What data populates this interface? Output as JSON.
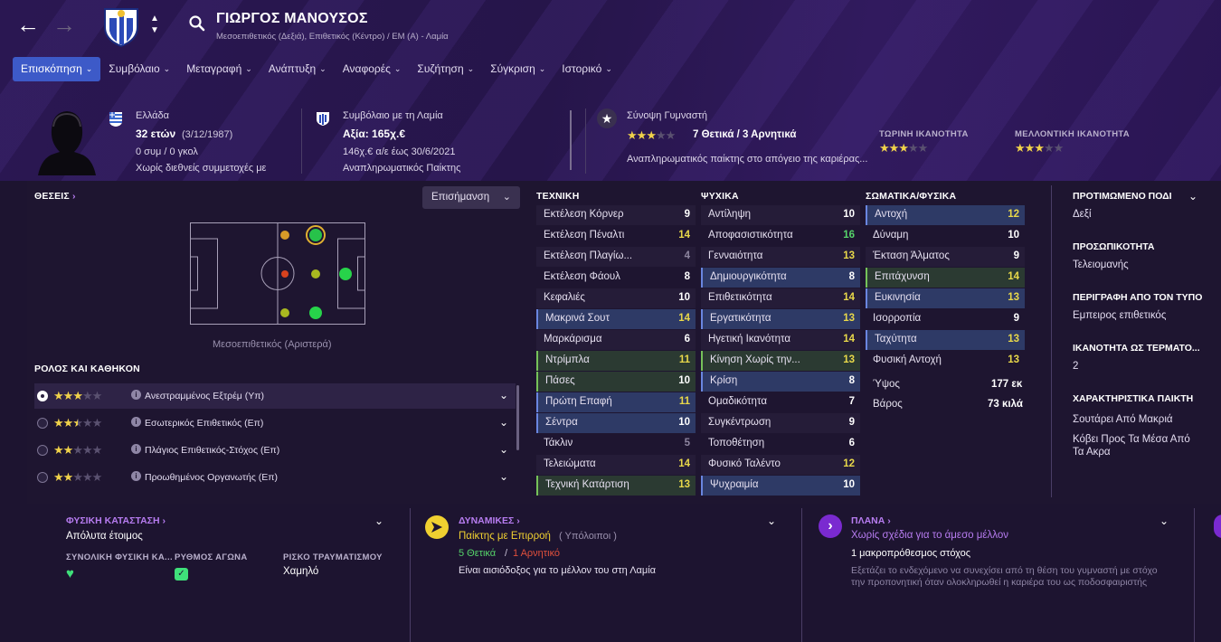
{
  "header": {
    "player_name": "ΓΙΩΡΓΟΣ ΜΑΝΟΥΣΟΣ",
    "subtitle": "Μεσοεπιθετικός (Δεξιά), Επιθετικός (Κέντρο) / ΕΜ (Α) - Λαμία",
    "back_icon": "←",
    "forward_icon": "→"
  },
  "tabs": [
    {
      "label": "Επισκόπηση",
      "active": true
    },
    {
      "label": "Συμβόλαιο"
    },
    {
      "label": "Μεταγραφή"
    },
    {
      "label": "Ανάπτυξη"
    },
    {
      "label": "Αναφορές"
    },
    {
      "label": "Συζήτηση"
    },
    {
      "label": "Σύγκριση"
    },
    {
      "label": "Ιστορικό"
    }
  ],
  "info": {
    "nation": "Ελλάδα",
    "age": "32 ετών",
    "dob": "(3/12/1987)",
    "caps": "0 συμ / 0 γκολ",
    "intl": "Χωρίς διεθνείς συμμετοχές με",
    "contract_title": "Συμβόλαιο με τη Λαμία",
    "value": "Αξία: 165χ.€",
    "wage": "146χ.€ α/ε έως 30/6/2021",
    "squad_status": "Αναπληρωματικός Παίκτης",
    "coach_summary": "Σύνοψη Γυμναστή",
    "coach_verdict": "7 Θετικά / 3 Αρνητικά",
    "coach_text": "Αναπληρωματικός παίκτης στο απόγειο της καριέρας...",
    "current_ability_label": "ΤΩΡΙΝΗ ΙΚΑΝΟΤΗΤΑ",
    "potential_ability_label": "ΜΕΛΛΟΝΤΙΚΗ ΙΚΑΝΟΤΗΤΑ",
    "coach_stars": 3,
    "current_stars": 3,
    "potential_stars": 3
  },
  "positions": {
    "heading": "ΘΕΣΕΙΣ",
    "highlight_button": "Επισήμανση",
    "caption": "Μεσοεπιθετικός (Αριστερά)"
  },
  "roles": {
    "heading": "ΡΟΛΟΣ ΚΑΙ ΚΑΘΗΚΟΝ",
    "items": [
      {
        "name": "Ανεστραμμένος Εξτρέμ (Υπ)",
        "stars": 3,
        "selected": true
      },
      {
        "name": "Εσωτερικός Επιθετικός (Επ)",
        "stars": 2.5
      },
      {
        "name": "Πλάγιος Επιθετικός-Στόχος (Επ)",
        "stars": 2
      },
      {
        "name": "Προωθημένος Οργανωτής (Επ)",
        "stars": 2
      }
    ]
  },
  "technical": {
    "heading": "ΤΕΧΝΙΚΗ",
    "items": [
      {
        "name": "Εκτέλεση Κόρνερ",
        "value": "9",
        "hl": "plain",
        "color": "white"
      },
      {
        "name": "Εκτέλεση Πέναλτι",
        "value": "14",
        "hl": "none",
        "color": "yellow"
      },
      {
        "name": "Εκτέλεση Πλαγίω...",
        "value": "4",
        "hl": "plain",
        "color": "grey"
      },
      {
        "name": "Εκτέλεση Φάουλ",
        "value": "8",
        "hl": "none",
        "color": "white"
      },
      {
        "name": "Κεφαλιές",
        "value": "10",
        "hl": "plain",
        "color": "white"
      },
      {
        "name": "Μακρινά Σουτ",
        "value": "14",
        "hl": "blue",
        "color": "yellow"
      },
      {
        "name": "Μαρκάρισμα",
        "value": "6",
        "hl": "plain",
        "color": "white"
      },
      {
        "name": "Ντρίμπλα",
        "value": "11",
        "hl": "green",
        "color": "yellow"
      },
      {
        "name": "Πάσες",
        "value": "10",
        "hl": "green",
        "color": "white"
      },
      {
        "name": "Πρώτη Επαφή",
        "value": "11",
        "hl": "blue",
        "color": "yellow"
      },
      {
        "name": "Σέντρα",
        "value": "10",
        "hl": "blue",
        "color": "white"
      },
      {
        "name": "Τάκλιν",
        "value": "5",
        "hl": "none",
        "color": "grey"
      },
      {
        "name": "Τελειώματα",
        "value": "14",
        "hl": "plain",
        "color": "yellow"
      },
      {
        "name": "Τεχνική Κατάρτιση",
        "value": "13",
        "hl": "green",
        "color": "yellow"
      }
    ]
  },
  "mental": {
    "heading": "ΨΥΧΙΚΑ",
    "items": [
      {
        "name": "Αντίληψη",
        "value": "10",
        "hl": "plain",
        "color": "white"
      },
      {
        "name": "Αποφασιστικότητα",
        "value": "16",
        "hl": "none",
        "color": "green"
      },
      {
        "name": "Γενναιότητα",
        "value": "13",
        "hl": "plain",
        "color": "yellow"
      },
      {
        "name": "Δημιουργικότητα",
        "value": "8",
        "hl": "blue",
        "color": "white"
      },
      {
        "name": "Επιθετικότητα",
        "value": "14",
        "hl": "plain",
        "color": "yellow"
      },
      {
        "name": "Εργατικότητα",
        "value": "13",
        "hl": "blue",
        "color": "yellow"
      },
      {
        "name": "Ηγετική Ικανότητα",
        "value": "14",
        "hl": "plain",
        "color": "yellow"
      },
      {
        "name": "Κίνηση Χωρίς την...",
        "value": "13",
        "hl": "green",
        "color": "yellow"
      },
      {
        "name": "Κρίση",
        "value": "8",
        "hl": "blue",
        "color": "white"
      },
      {
        "name": "Ομαδικότητα",
        "value": "7",
        "hl": "none",
        "color": "white"
      },
      {
        "name": "Συγκέντρωση",
        "value": "9",
        "hl": "plain",
        "color": "white"
      },
      {
        "name": "Τοποθέτηση",
        "value": "6",
        "hl": "none",
        "color": "white"
      },
      {
        "name": "Φυσικό Ταλέντο",
        "value": "12",
        "hl": "plain",
        "color": "yellow"
      },
      {
        "name": "Ψυχραιμία",
        "value": "10",
        "hl": "blue",
        "color": "white"
      }
    ]
  },
  "physical": {
    "heading": "ΣΩΜΑΤΙΚΑ/ΦΥΣΙΚΑ",
    "items": [
      {
        "name": "Αντοχή",
        "value": "12",
        "hl": "blue",
        "color": "yellow"
      },
      {
        "name": "Δύναμη",
        "value": "10",
        "hl": "none",
        "color": "white"
      },
      {
        "name": "Έκταση Άλματος",
        "value": "9",
        "hl": "plain",
        "color": "white"
      },
      {
        "name": "Επιτάχυνση",
        "value": "14",
        "hl": "green",
        "color": "yellow"
      },
      {
        "name": "Ευκινησία",
        "value": "13",
        "hl": "blue",
        "color": "yellow"
      },
      {
        "name": "Ισορροπία",
        "value": "9",
        "hl": "none",
        "color": "white"
      },
      {
        "name": "Ταχύτητα",
        "value": "13",
        "hl": "blue",
        "color": "yellow"
      },
      {
        "name": "Φυσική Αντοχή",
        "value": "13",
        "hl": "none",
        "color": "yellow"
      }
    ],
    "height_label": "Ύψος",
    "height": "177 εκ",
    "weight_label": "Βάρος",
    "weight": "73 κιλά"
  },
  "side": {
    "foot_h": "ΠΡΟΤΙΜΩΜΕΝΟ ΠΟΔΙ",
    "foot_v": "Δεξί",
    "pers_h": "ΠΡΟΣΩΠΙΚΟΤΗΤΑ",
    "pers_v": "Τελειομανής",
    "media_h": "ΠΕΡΙΓΡΑΦΗ ΑΠΟ ΤΟΝ ΤΥΠΟ",
    "media_v": "Εμπειρος επιθετικός",
    "goal_h": "ΙΚΑΝΟΤΗΤΑ ΩΣ ΤΕΡΜΑΤΟ...",
    "goal_v": "2",
    "traits_h": "ΧΑΡΑΚΤΗΡΙΣΤΙΚΑ ΠΑΙΚΤΗ",
    "trait1": "Σουτάρει Από Μακριά",
    "trait2a": "Κόβει Προς Τα Μέσα Από",
    "trait2b": "Τα Ακρα"
  },
  "bottom": {
    "cond_h": "ΦΥΣΙΚΗ ΚΑΤΑΣΤΑΣΗ",
    "cond_v": "Απόλυτα έτοιμος",
    "cond_c1": "ΣΥΝΟΛΙΚΗ ΦΥΣΙΚΗ ΚΑ...",
    "cond_c2": "ΡΥΘΜΟΣ ΑΓΩΝΑ",
    "cond_c3": "ΡΙΣΚΟ ΤΡΑΥΜΑΤΙΣΜΟΥ",
    "cond_risk": "Χαμηλό",
    "dyn_h": "ΔΥΝΑΜΙΚΕΣ",
    "dyn_v": "Παίκτης με Επιρροή",
    "dyn_v2": "( Υπόλοιποι )",
    "dyn_pos": "5 Θετικά",
    "dyn_sep": "/",
    "dyn_neg": "1 Αρνητικό",
    "dyn_text": "Είναι αισιόδοξος για το μέλλον του στη Λαμία",
    "plans_h": "ΠΛΑΝΑ",
    "plans_v": "Χωρίς σχέδια για το άμεσο μέλλον",
    "plans_goal": "1 μακροπρόθεσμος στόχος",
    "plans_t1": "Εξετάζει το ενδεχόμενο να συνεχίσει από τη θέση του γυμναστή με στόχο",
    "plans_t2": "την προπονητική όταν ολοκληρωθεί η καριέρα του ως ποδοσφαιριστής"
  },
  "colors": {
    "accent": "#3d5ac8",
    "star": "#f0d24a",
    "positive": "#56d46a",
    "negative": "#e0503c",
    "section_purple": "#b77cf0"
  }
}
